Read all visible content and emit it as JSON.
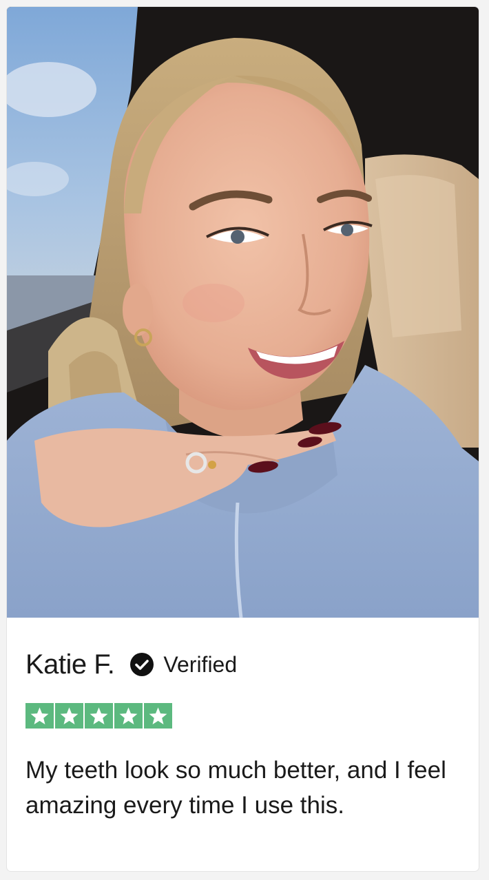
{
  "review": {
    "photo_icon": "reviewer-selfie-photo",
    "name": "Katie F.",
    "verified_icon": "check-circle-icon",
    "verified_label": "Verified",
    "rating": 5,
    "rating_max": 5,
    "star_color": "#5cb97f",
    "text": "My teeth look so much better, and I feel amazing every time I use this."
  }
}
